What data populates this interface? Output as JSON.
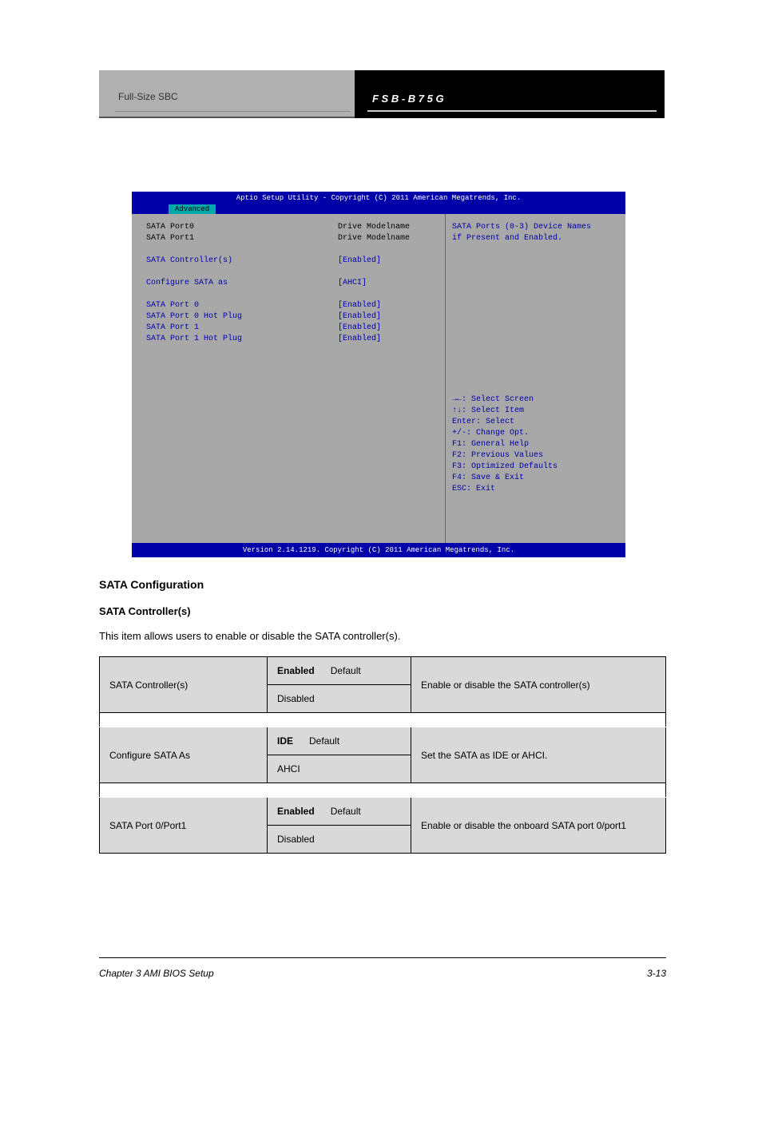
{
  "header": {
    "left": "Full-Size SBC",
    "right": "F S B - B 7 5 G"
  },
  "bios": {
    "title": "Aptio Setup Utility - Copyright (C) 2011 American Megatrends, Inc.",
    "tab": "Advanced",
    "rows": [
      {
        "k": "SATA Port0",
        "v": "Drive Modelname",
        "cls": "white"
      },
      {
        "k": "SATA Port1",
        "v": "Drive Modelname",
        "cls": "white"
      },
      {
        "gap": true
      },
      {
        "k": "SATA Controller(s)",
        "v": "[Enabled]"
      },
      {
        "gap": true
      },
      {
        "k": "Configure SATA as",
        "v": "[AHCI]"
      },
      {
        "gap": true
      },
      {
        "k": "    SATA Port 0",
        "v": "[Enabled]"
      },
      {
        "k": "    SATA Port 0 Hot Plug",
        "v": "[Enabled]"
      },
      {
        "k": "    SATA Port 1",
        "v": "[Enabled]"
      },
      {
        "k": "    SATA Port 1 Hot Plug",
        "v": "[Enabled]"
      }
    ],
    "help1": "SATA Ports (0-3) Device Names\nif Present and Enabled.",
    "help2": "→←: Select Screen\n↑↓: Select Item\nEnter: Select\n+/-: Change Opt.\nF1: General Help\nF2: Previous Values\nF3: Optimized Defaults\nF4: Save & Exit\nESC: Exit",
    "footer": "Version 2.14.1219. Copyright (C) 2011 American Megatrends, Inc."
  },
  "body": {
    "heading": "SATA Configuration",
    "subhead": "SATA Controller(s)",
    "para": "This item allows users to enable or disable the SATA controller(s).",
    "table": [
      {
        "label": "SATA Controller(s)",
        "vals": [
          "Enabled",
          "Disabled"
        ],
        "def": "Default",
        "desc": "Enable or disable the SATA controller(s)"
      },
      {
        "label": "Configure SATA As",
        "vals": [
          "IDE",
          "AHCI"
        ],
        "def": "Default",
        "desc": "Set the SATA as IDE or AHCI."
      },
      {
        "label": "SATA Port 0/Port1",
        "vals": [
          "Enabled",
          "Disabled"
        ],
        "def": "Default",
        "desc": "Enable or disable the onboard SATA port 0/port1"
      }
    ]
  },
  "footer": {
    "left": "Chapter 3 AMI BIOS Setup",
    "right": "3-13"
  }
}
